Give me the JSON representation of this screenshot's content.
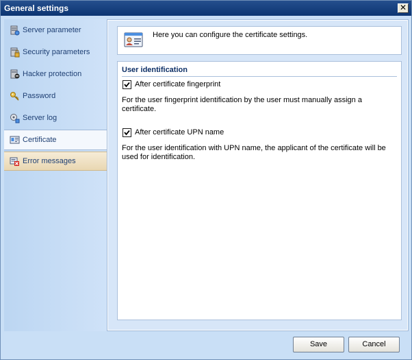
{
  "window": {
    "title": "General settings",
    "close_symbol": "✕"
  },
  "sidebar": {
    "items": [
      {
        "label": "Server parameter",
        "icon": "server-parameter-icon"
      },
      {
        "label": "Security parameters",
        "icon": "security-parameters-icon"
      },
      {
        "label": "Hacker protection",
        "icon": "hacker-protection-icon"
      },
      {
        "label": "Password",
        "icon": "key-icon"
      },
      {
        "label": "Server log",
        "icon": "server-log-icon"
      },
      {
        "label": "Certificate",
        "icon": "certificate-icon",
        "selected": true
      },
      {
        "label": "Error messages",
        "icon": "error-messages-icon",
        "hover": true
      }
    ]
  },
  "info": {
    "text": "Here you can configure the certificate settings.",
    "icon": "certificate-card-icon"
  },
  "user_identification": {
    "title": "User identification",
    "fingerprint": {
      "label": "After certificate fingerprint",
      "checked": true,
      "description": "For the user fingerprint identification by the user must manually assign a certificate."
    },
    "upn": {
      "label": "After certificate UPN name",
      "checked": true,
      "description": "For the user identification with UPN name, the applicant of the certificate will be used for identification."
    }
  },
  "buttons": {
    "save": "Save",
    "cancel": "Cancel"
  },
  "colors": {
    "title_bar": "#0c3572",
    "sidebar_text": "#1e3f73",
    "accent_panel": "#d7e6f8"
  }
}
